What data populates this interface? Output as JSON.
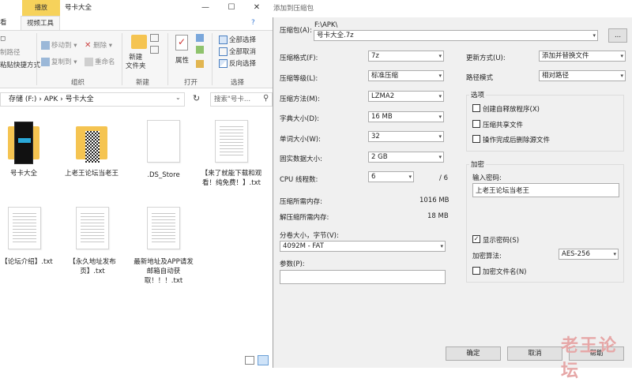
{
  "explorer": {
    "context_tab": "播放",
    "window_title": "号卡大全",
    "ribbon_tabs": [
      "看",
      "视频工具"
    ],
    "organize": {
      "move_to": "移动到",
      "copy_to": "复制到",
      "delete": "删除",
      "rename": "重命名",
      "group": "组织"
    },
    "left_cut": {
      "copy_path": "制路径",
      "paste_shortcut": "粘贴快捷方式"
    },
    "new": {
      "new_folder": "新建\n文件夹",
      "group": "新建"
    },
    "open": {
      "properties": "属性",
      "group": "打开"
    },
    "select": {
      "select_all": "全部选择",
      "select_none": "全部取消",
      "invert": "反向选择",
      "group": "选择"
    },
    "breadcrumb": [
      "存储 (F:)",
      "APK",
      "号卡大全"
    ],
    "search_placeholder": "搜索\"号卡...",
    "files": [
      {
        "name": "号卡大全",
        "kind": "folder-dark"
      },
      {
        "name": "上老王论坛当老王",
        "kind": "folder-qr"
      },
      {
        "name": ".DS_Store",
        "kind": "blank"
      },
      {
        "name": "【来了就能下载和观看！纯免费！】.txt",
        "kind": "txt"
      },
      {
        "name": "【论坛介绍】.txt",
        "kind": "txt"
      },
      {
        "name": "【永久地址发布页】.txt",
        "kind": "txt"
      },
      {
        "name": "最新地址及APP请发邮箱自动获取！！！.txt",
        "kind": "txt"
      }
    ]
  },
  "dialog": {
    "title": "添加到压缩包",
    "archive_label": "压缩包(A):",
    "archive_path": "F:\\APK\\",
    "archive_name": "号卡大全.7z",
    "browse": "...",
    "format_label": "压缩格式(F):",
    "format_value": "7z",
    "level_label": "压缩等级(L):",
    "level_value": "标准压缩",
    "method_label": "压缩方法(M):",
    "method_value": "LZMA2",
    "dict_label": "字典大小(D):",
    "dict_value": "16 MB",
    "word_label": "单词大小(W):",
    "word_value": "32",
    "solid_label": "固实数据大小:",
    "solid_value": "2 GB",
    "cpu_label": "CPU 线程数:",
    "cpu_value": "6",
    "cpu_total": "/ 6",
    "mem_comp_label": "压缩所需内存:",
    "mem_comp_value": "1016 MB",
    "mem_decomp_label": "解压缩所需内存:",
    "mem_decomp_value": "18 MB",
    "split_label": "分卷大小，字节(V):",
    "split_value": "4092M - FAT",
    "params_label": "参数(P):",
    "params_value": "",
    "update_label": "更新方式(U):",
    "update_value": "添加并替换文件",
    "path_label": "路径模式",
    "path_value": "相对路径",
    "options_title": "选项",
    "opt_sfx": "创建自释放程序(X)",
    "opt_shared": "压缩共享文件",
    "opt_delete": "操作完成后删除源文件",
    "encrypt_title": "加密",
    "password_label": "输入密码:",
    "password_value": "上老王论坛当老王",
    "show_password": "显示密码(S)",
    "enc_method_label": "加密算法:",
    "enc_method_value": "AES-256",
    "enc_names": "加密文件名(N)",
    "ok": "确定",
    "cancel": "取消",
    "help": "帮助",
    "watermark": "老王论坛"
  }
}
